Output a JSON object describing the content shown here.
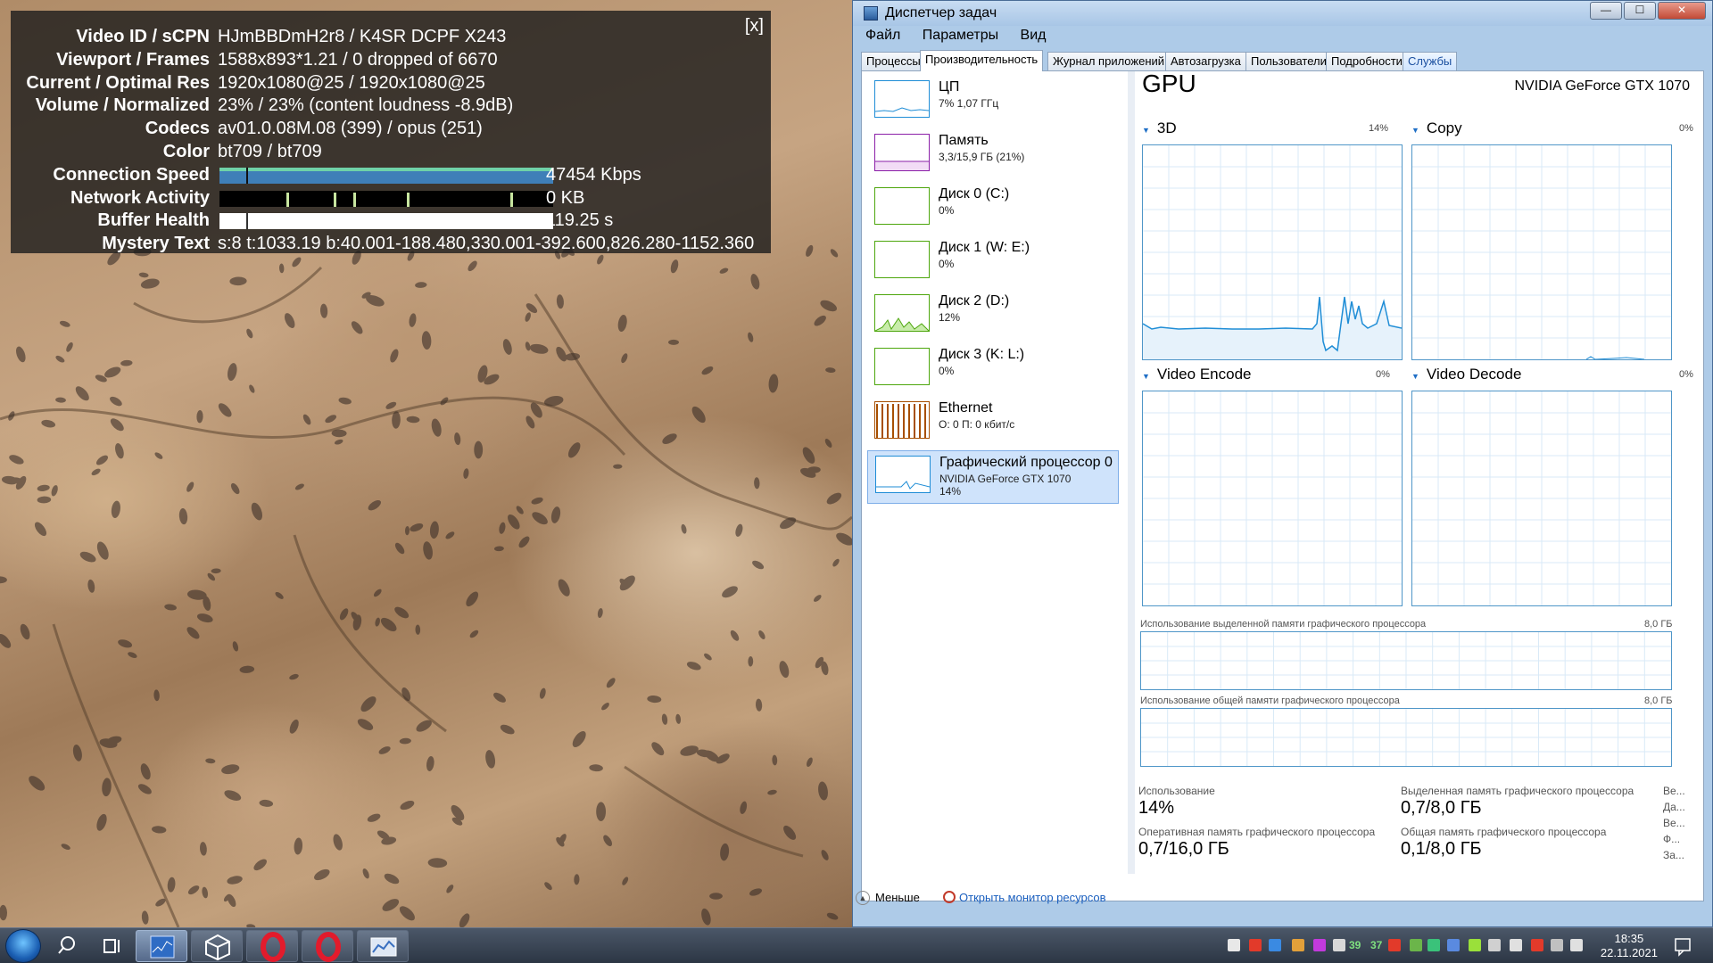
{
  "stats": {
    "close_label": "[x]",
    "rows": [
      {
        "label": "Video ID / sCPN",
        "value": "HJmBBDmH2r8 / K4SR DCPF X243"
      },
      {
        "label": "Viewport / Frames",
        "value": "1588x893*1.21 / 0 dropped of 6670"
      },
      {
        "label": "Current / Optimal Res",
        "value": "1920x1080@25 / 1920x1080@25"
      },
      {
        "label": "Volume / Normalized",
        "value": "23% / 23% (content loudness -8.9dB)"
      },
      {
        "label": "Codecs",
        "value": "av01.0.08M.08 (399) / opus (251)"
      },
      {
        "label": "Color",
        "value": "bt709 / bt709"
      },
      {
        "label": "Connection Speed",
        "value": "47454 Kbps",
        "bar": "connection"
      },
      {
        "label": "Network Activity",
        "value": "0 KB",
        "bar": "network"
      },
      {
        "label": "Buffer Health",
        "value": "119.25 s",
        "bar": "buffer"
      },
      {
        "label": "Mystery Text",
        "value": "s:8 t:1033.19 b:40.001-188.480,330.001-392.600,826.280-1152.360"
      }
    ],
    "colors": {
      "connection": "#3f7fb8",
      "network_spikes": "#c8e6a0",
      "buffer": "#ffffff"
    }
  },
  "task_manager": {
    "title": "Диспетчер задач",
    "window_buttons": {
      "min": "—",
      "max": "☐",
      "close": "✕"
    },
    "menu": [
      "Файл",
      "Параметры",
      "Вид"
    ],
    "tabs": [
      "Процессы",
      "Производительность",
      "Журнал приложений",
      "Автозагрузка",
      "Пользователи",
      "Подробности",
      "Службы"
    ],
    "active_tab": "Производительность",
    "resources": [
      {
        "name": "ЦП",
        "sub": "7% 1,07 ГГц",
        "color": "#1f8dd6"
      },
      {
        "name": "Память",
        "sub": "3,3/15,9 ГБ (21%)",
        "color": "#8b1fa8"
      },
      {
        "name": "Диск 0 (C:)",
        "sub": "0%",
        "color": "#4da60c"
      },
      {
        "name": "Диск 1 (W: E:)",
        "sub": "0%",
        "color": "#4da60c"
      },
      {
        "name": "Диск 2 (D:)",
        "sub": "12%",
        "color": "#4da60c"
      },
      {
        "name": "Диск 3 (K: L:)",
        "sub": "0%",
        "color": "#4da60c"
      },
      {
        "name": "Ethernet",
        "sub": "О: 0 П: 0 кбит/с",
        "color": "#a74f01"
      },
      {
        "name": "Графический процессор 0",
        "sub": "NVIDIA GeForce GTX 1070",
        "sub2": "14%",
        "color": "#1f8dd6"
      }
    ],
    "gpu": {
      "title": "GPU",
      "name": "NVIDIA GeForce GTX 1070",
      "engines": [
        {
          "label": "3D",
          "pct": "14%"
        },
        {
          "label": "Copy",
          "pct": "0%"
        },
        {
          "label": "Video Encode",
          "pct": "0%"
        },
        {
          "label": "Video Decode",
          "pct": "0%"
        }
      ],
      "dedicated_label": "Использование выделенной памяти графического процессора",
      "dedicated_max": "8,0 ГБ",
      "shared_label": "Использование общей памяти графического процессора",
      "shared_max": "8,0 ГБ",
      "stats": [
        {
          "label": "Использование",
          "value": "14%"
        },
        {
          "label": "Выделенная память графического процессора",
          "value": "0,7/8,0 ГБ"
        },
        {
          "label": "Оперативная память графического процессора",
          "value": "0,7/16,0 ГБ"
        },
        {
          "label": "Общая память графического процессора",
          "value": "0,1/8,0 ГБ"
        }
      ],
      "truncated": [
        "Ве...",
        "Да...",
        "Ве...",
        "Ф...",
        "За..."
      ]
    },
    "bottom": {
      "less": "Меньше",
      "monitor": "Открыть монитор ресурсов"
    }
  },
  "taskbar": {
    "tray_numbers": [
      "39",
      "37"
    ],
    "time": "18:35",
    "date": "22.11.2021"
  }
}
